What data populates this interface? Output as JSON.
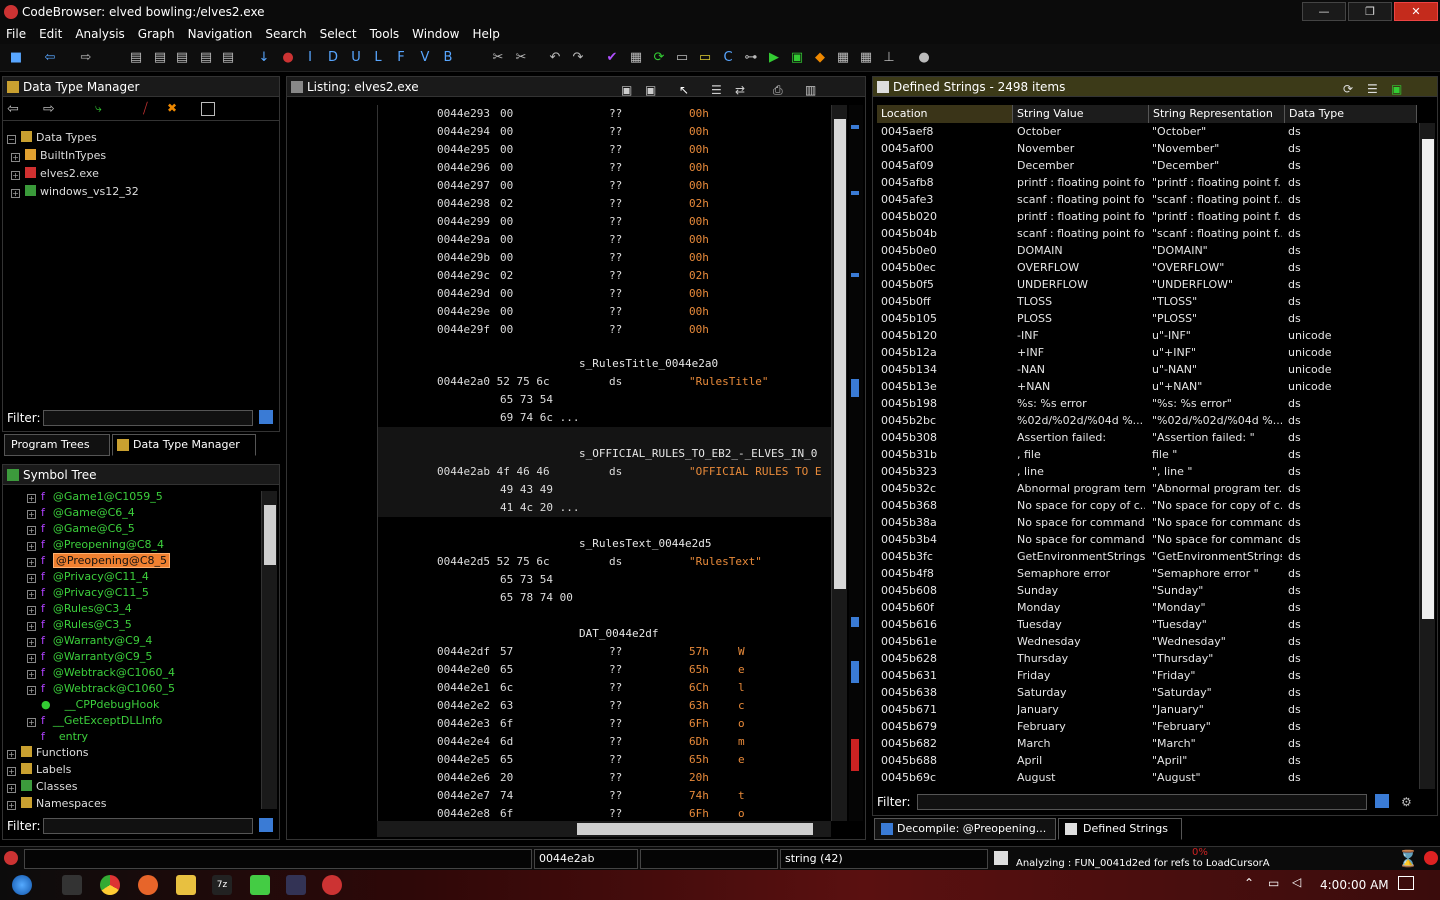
{
  "window": {
    "title": "CodeBrowser: elved bowling:/elves2.exe",
    "min": "—",
    "max": "❐",
    "close": "✕"
  },
  "menu": [
    "File",
    "Edit",
    "Analysis",
    "Graph",
    "Navigation",
    "Search",
    "Select",
    "Tools",
    "Window",
    "Help"
  ],
  "dtm": {
    "title": "Data Type Manager",
    "root": "Data Types",
    "items": [
      "BuiltInTypes",
      "elves2.exe",
      "windows_vs12_32"
    ],
    "filter_label": "Filter:",
    "filter_value": ""
  },
  "lefttabs": {
    "program_trees": "Program Trees",
    "data_type_manager": "Data Type Manager"
  },
  "symtree": {
    "title": "Symbol Tree",
    "items": [
      "@Game1@C1059_5",
      "@Game@C6_4",
      "@Game@C6_5",
      "@Preopening@C8_4",
      "@Preopening@C8_5",
      "@Privacy@C11_4",
      "@Privacy@C11_5",
      "@Rules@C3_4",
      "@Rules@C3_5",
      "@Warranty@C9_4",
      "@Warranty@C9_5",
      "@Webtrack@C1060_4",
      "@Webtrack@C1060_5",
      "__CPPdebugHook",
      "__GetExceptDLLInfo",
      "entry"
    ],
    "folders": [
      "Functions",
      "Labels",
      "Classes",
      "Namespaces"
    ],
    "filter_label": "Filter:",
    "filter_value": ""
  },
  "listing": {
    "title": "Listing:  elves2.exe",
    "rows1": [
      [
        "0044e293",
        "00",
        "??",
        "00h"
      ],
      [
        "0044e294",
        "00",
        "??",
        "00h"
      ],
      [
        "0044e295",
        "00",
        "??",
        "00h"
      ],
      [
        "0044e296",
        "00",
        "??",
        "00h"
      ],
      [
        "0044e297",
        "00",
        "??",
        "00h"
      ],
      [
        "0044e298",
        "02",
        "??",
        "02h"
      ],
      [
        "0044e299",
        "00",
        "??",
        "00h"
      ],
      [
        "0044e29a",
        "00",
        "??",
        "00h"
      ],
      [
        "0044e29b",
        "00",
        "??",
        "00h"
      ],
      [
        "0044e29c",
        "02",
        "??",
        "02h"
      ],
      [
        "0044e29d",
        "00",
        "??",
        "00h"
      ],
      [
        "0044e29e",
        "00",
        "??",
        "00h"
      ],
      [
        "0044e29f",
        "00",
        "??",
        "00h"
      ]
    ],
    "label1": "s_RulesTitle_0044e2a0",
    "r1a": "0044e2a0 52 75 6c",
    "r1b": "ds",
    "r1c": "\"RulesTitle\"",
    "r1d": "65 73 54",
    "r1e": "69 74 6c ...",
    "label2": "s_OFFICIAL_RULES_TO_EB2_-_ELVES_IN_0",
    "r2a": "0044e2ab 4f 46 46",
    "r2b": "ds",
    "r2c": "\"OFFICIAL RULES TO E",
    "r2d": "49 43 49",
    "r2e": "41 4c 20 ...",
    "label3": "s_RulesText_0044e2d5",
    "r3a": "0044e2d5 52 75 6c",
    "r3b": "ds",
    "r3c": "\"RulesText\"",
    "r3d": "65 73 54",
    "r3e": "65 78 74 00",
    "label4": "DAT_0044e2df",
    "rows2": [
      [
        "0044e2df",
        "57",
        "??",
        "57h",
        "W"
      ],
      [
        "0044e2e0",
        "65",
        "??",
        "65h",
        "e"
      ],
      [
        "0044e2e1",
        "6c",
        "??",
        "6Ch",
        "l"
      ],
      [
        "0044e2e2",
        "63",
        "??",
        "63h",
        "c"
      ],
      [
        "0044e2e3",
        "6f",
        "??",
        "6Fh",
        "o"
      ],
      [
        "0044e2e4",
        "6d",
        "??",
        "6Dh",
        "m"
      ],
      [
        "0044e2e5",
        "65",
        "??",
        "65h",
        "e"
      ],
      [
        "0044e2e6",
        "20",
        "??",
        "20h",
        ""
      ],
      [
        "0044e2e7",
        "74",
        "??",
        "74h",
        "t"
      ],
      [
        "0044e2e8",
        "6f",
        "??",
        "6Fh",
        "o"
      ]
    ]
  },
  "strings": {
    "title": "Defined Strings - 2498 items",
    "cols": [
      "Location",
      "String Value",
      "String Representation",
      "Data Type"
    ],
    "rows": [
      [
        "0045aef8",
        "October",
        "\"October\"",
        "ds"
      ],
      [
        "0045af00",
        "November",
        "\"November\"",
        "ds"
      ],
      [
        "0045af09",
        "December",
        "\"December\"",
        "ds"
      ],
      [
        "0045afb8",
        "printf : floating point fo...",
        "\"printf : floating point f...",
        "ds"
      ],
      [
        "0045afe3",
        "scanf : floating point fo...",
        "\"scanf : floating point f...",
        "ds"
      ],
      [
        "0045b020",
        "printf : floating point fo...",
        "\"printf : floating point f...",
        "ds"
      ],
      [
        "0045b04b",
        "scanf : floating point fo...",
        "\"scanf : floating point f...",
        "ds"
      ],
      [
        "0045b0e0",
        "DOMAIN",
        "\"DOMAIN\"",
        "ds"
      ],
      [
        "0045b0ec",
        "OVERFLOW",
        "\"OVERFLOW\"",
        "ds"
      ],
      [
        "0045b0f5",
        "UNDERFLOW",
        "\"UNDERFLOW\"",
        "ds"
      ],
      [
        "0045b0ff",
        "TLOSS",
        "\"TLOSS\"",
        "ds"
      ],
      [
        "0045b105",
        "PLOSS",
        "\"PLOSS\"",
        "ds"
      ],
      [
        "0045b120",
        "-INF",
        "u\"-INF\"",
        "unicode"
      ],
      [
        "0045b12a",
        "+INF",
        "u\"+INF\"",
        "unicode"
      ],
      [
        "0045b134",
        "-NAN",
        "u\"-NAN\"",
        "unicode"
      ],
      [
        "0045b13e",
        "+NAN",
        "u\"+NAN\"",
        "unicode"
      ],
      [
        "0045b198",
        "%s: %s error",
        "\"%s: %s error\"",
        "ds"
      ],
      [
        "0045b2bc",
        "%02d/%02d/%04d %...",
        "\"%02d/%02d/%04d %...",
        "ds"
      ],
      [
        "0045b308",
        "Assertion failed:",
        "\"Assertion failed: \"",
        "ds"
      ],
      [
        "0045b31b",
        ", file",
        "",
        " file \"",
        "ds"
      ],
      [
        "0045b323",
        ", line",
        "\", line \"",
        "ds"
      ],
      [
        "0045b32c",
        "Abnormal program term...",
        "\"Abnormal program ter...",
        "ds"
      ],
      [
        "0045b368",
        "No space for copy of c...",
        "\"No space for copy of c...",
        "ds"
      ],
      [
        "0045b38a",
        "No space for command ...",
        "\"No space for command...",
        "ds"
      ],
      [
        "0045b3b4",
        "No space for command ...",
        "\"No space for command...",
        "ds"
      ],
      [
        "0045b3fc",
        "GetEnvironmentStrings ...",
        "\"GetEnvironmentStrings...",
        "ds"
      ],
      [
        "0045b4f8",
        "Semaphore error",
        "\"Semaphore error \"",
        "ds"
      ],
      [
        "0045b608",
        "Sunday",
        "\"Sunday\"",
        "ds"
      ],
      [
        "0045b60f",
        "Monday",
        "\"Monday\"",
        "ds"
      ],
      [
        "0045b616",
        "Tuesday",
        "\"Tuesday\"",
        "ds"
      ],
      [
        "0045b61e",
        "Wednesday",
        "\"Wednesday\"",
        "ds"
      ],
      [
        "0045b628",
        "Thursday",
        "\"Thursday\"",
        "ds"
      ],
      [
        "0045b631",
        "Friday",
        "\"Friday\"",
        "ds"
      ],
      [
        "0045b638",
        "Saturday",
        "\"Saturday\"",
        "ds"
      ],
      [
        "0045b671",
        "January",
        "\"January\"",
        "ds"
      ],
      [
        "0045b679",
        "February",
        "\"February\"",
        "ds"
      ],
      [
        "0045b682",
        "March",
        "\"March\"",
        "ds"
      ],
      [
        "0045b688",
        "April",
        "\"April\"",
        "ds"
      ],
      [
        "0045b69c",
        "August",
        "\"August\"",
        "ds"
      ]
    ],
    "filter_label": "Filter:",
    "filter_value": ""
  },
  "righttabs": {
    "decompile": "Decompile: @Preopening...",
    "defined_strings": "Defined Strings"
  },
  "status": {
    "address": "0044e2ab",
    "type": "string  (42)",
    "progress": "0%",
    "analyzing": "Analyzing : FUN_0041d2ed for refs to LoadCursorA"
  },
  "taskbar": {
    "clock": "4:00:00 AM"
  },
  "colors": {
    "accent": "#e88a3a",
    "selection": "#f08030",
    "symbol": "#3ccf3c"
  }
}
